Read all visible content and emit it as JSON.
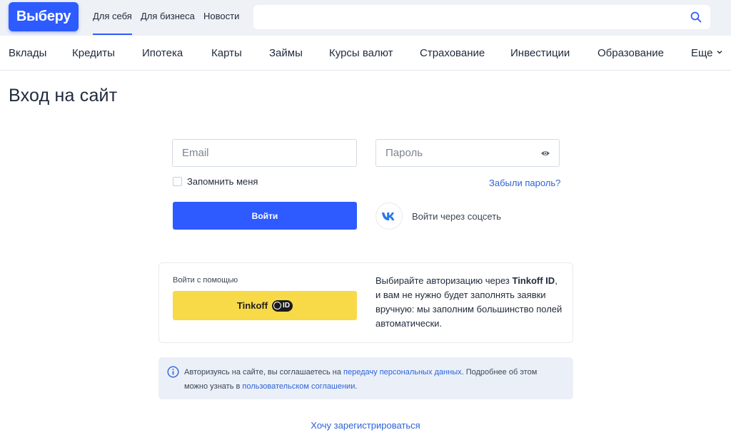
{
  "header": {
    "logo": "Выберу",
    "tabs": [
      {
        "label": "Для себя",
        "active": true
      },
      {
        "label": "Для бизнеса",
        "active": false
      },
      {
        "label": "Новости",
        "active": false
      }
    ],
    "search": {
      "value": "",
      "placeholder": ""
    }
  },
  "nav": {
    "items": [
      "Вклады",
      "Кредиты",
      "Ипотека",
      "Карты",
      "Займы",
      "Курсы валют",
      "Страхование",
      "Инвестиции",
      "Образование"
    ],
    "more": "Еще"
  },
  "page": {
    "title": "Вход на сайт"
  },
  "form": {
    "email_placeholder": "Email",
    "password_placeholder": "Пароль",
    "remember": "Запомнить меня",
    "forgot": "Забыли пароль?",
    "submit": "Войти",
    "social": "Войти через соцсеть"
  },
  "tinkoff": {
    "label": "Войти с помощью",
    "button": "Tinkoff",
    "badge": "ID",
    "desc_pre": "Выбирайте авторизацию через ",
    "desc_bold": "Tinkoff ID",
    "desc_post": ", и вам не нужно будет заполнять заявки вручную: мы заполним большинство полей автоматически."
  },
  "info": {
    "t1": "Авторизуясь на сайте, вы соглашаетесь на ",
    "link1": "передачу персональных данных",
    "t2": ". Подробнее об этом можно узнать в ",
    "link2": "пользовательском соглашении",
    "t3": "."
  },
  "register": "Хочу зарегистрироваться",
  "colors": {
    "accent": "#2d5bff",
    "link": "#2d63d8",
    "tinkoff": "#f8d948",
    "info_bg": "#ebf0f8"
  }
}
